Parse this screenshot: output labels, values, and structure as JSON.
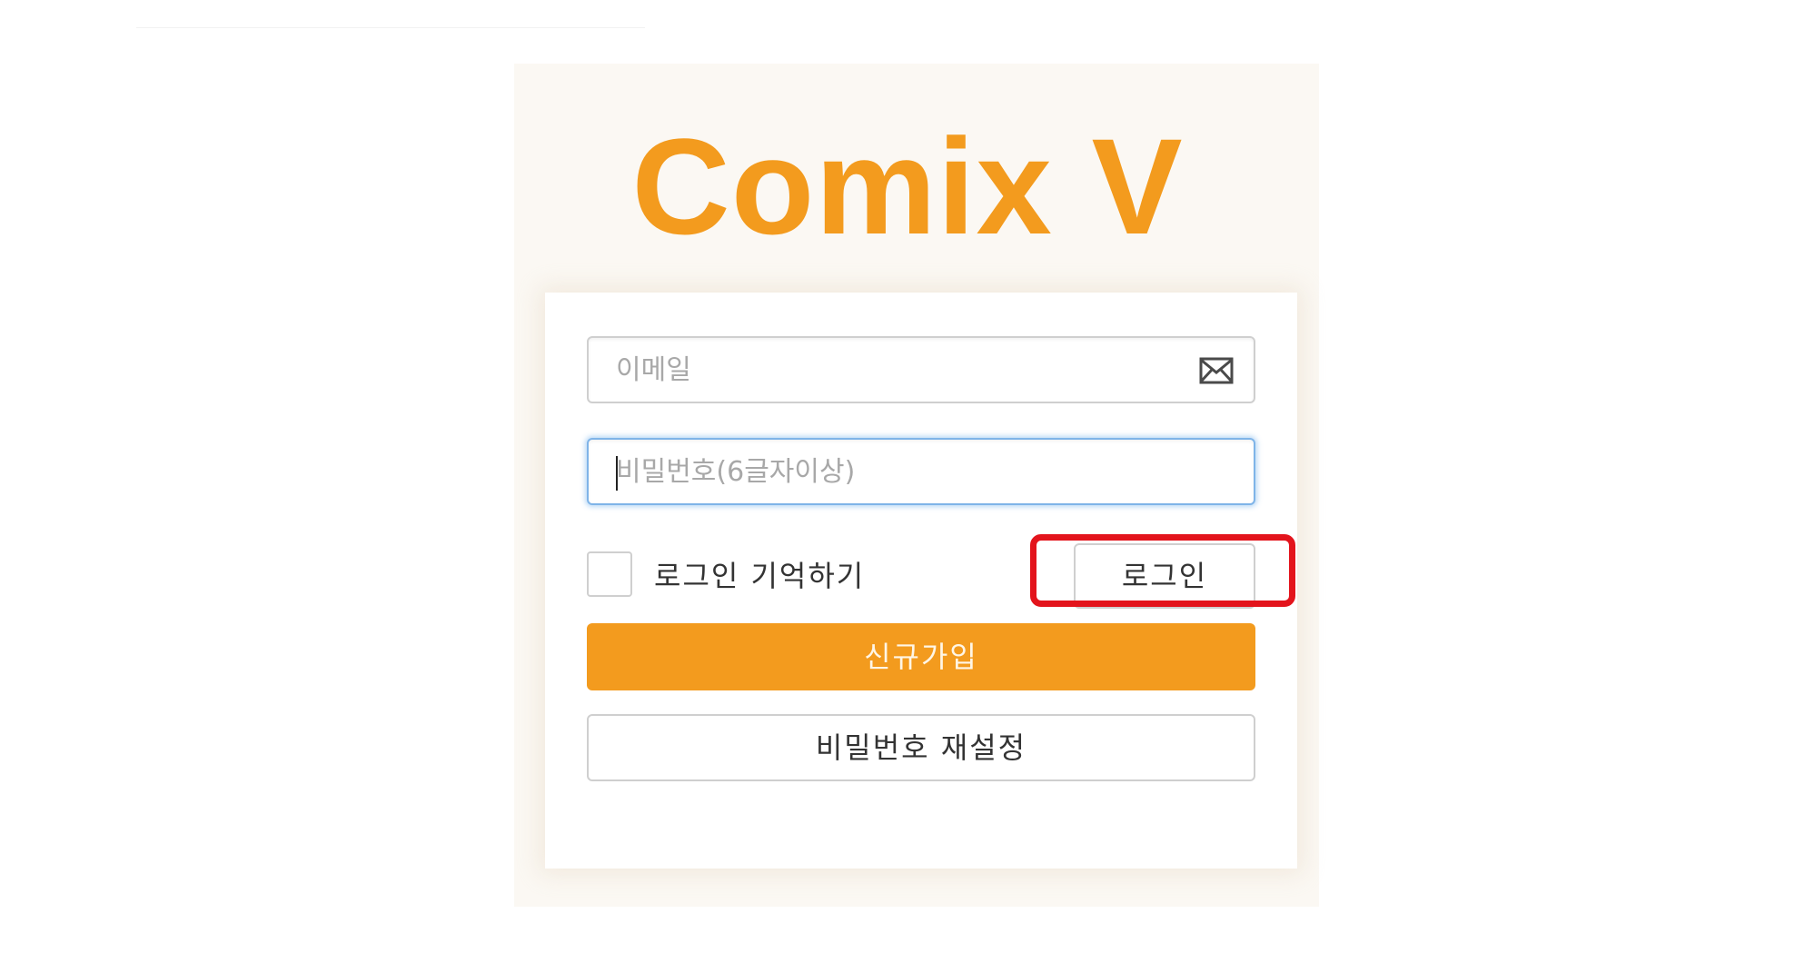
{
  "brand": {
    "logo_text": "Comix V",
    "accent_color": "#f39b1e"
  },
  "login_form": {
    "email": {
      "placeholder": "이메일",
      "value": "",
      "icon": "envelope-icon"
    },
    "password": {
      "placeholder": "비밀번호(6글자이상)",
      "value": "",
      "focused": true
    },
    "remember_me": {
      "label": "로그인 기억하기",
      "checked": false
    },
    "login_button": {
      "label": "로그인",
      "highlighted": true,
      "highlight_color": "#e3141c"
    },
    "signup_button": {
      "label": "신규가입"
    },
    "reset_password_button": {
      "label": "비밀번호 재설정"
    }
  }
}
